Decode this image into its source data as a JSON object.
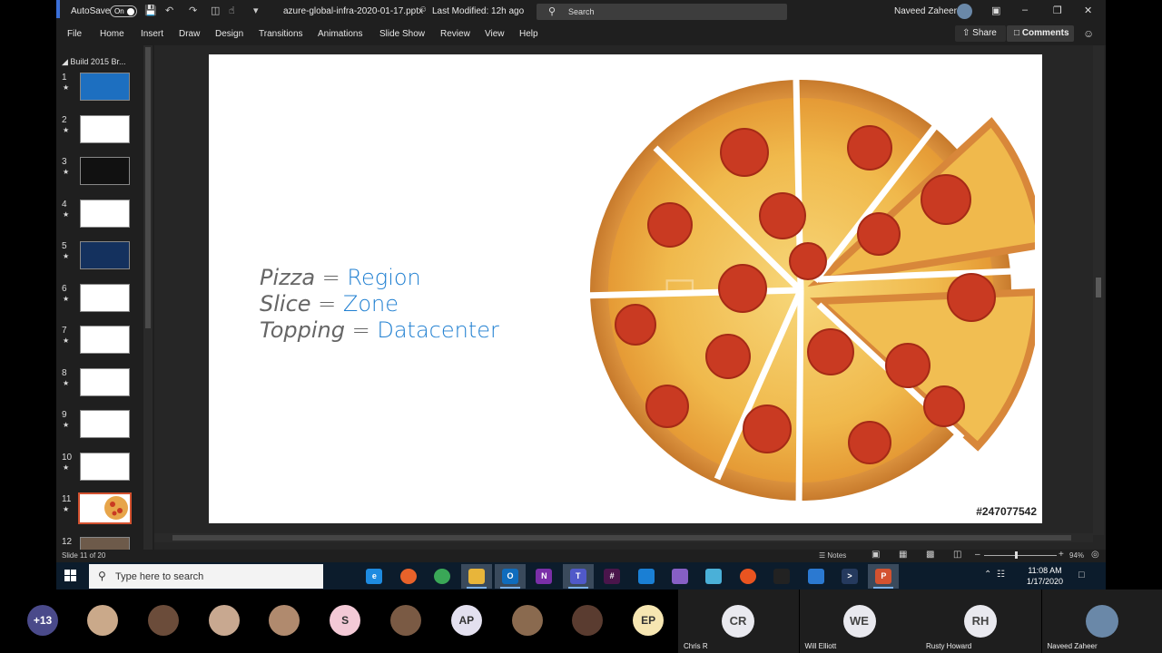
{
  "titlebar": {
    "autosave_label": "AutoSave",
    "autosave_state": "On",
    "filename": "azure-global-infra-2020-01-17.pptx",
    "last_modified": "Last Modified: 12h ago",
    "search_placeholder": "Search",
    "user_name": "Naveed Zaheer"
  },
  "menu": {
    "items": [
      "File",
      "Home",
      "Insert",
      "Draw",
      "Design",
      "Transitions",
      "Animations",
      "Slide Show",
      "Review",
      "View",
      "Help"
    ],
    "share": "Share",
    "comments": "Comments"
  },
  "slides_panel": {
    "section": "Build 2015 Br...",
    "thumbs": [
      {
        "num": "1",
        "bg": "#1d6fc0"
      },
      {
        "num": "2",
        "bg": "#ffffff"
      },
      {
        "num": "3",
        "bg": "#111111"
      },
      {
        "num": "4",
        "bg": "#ffffff"
      },
      {
        "num": "5",
        "bg": "#14315e"
      },
      {
        "num": "6",
        "bg": "#ffffff"
      },
      {
        "num": "7",
        "bg": "#ffffff"
      },
      {
        "num": "8",
        "bg": "#ffffff"
      },
      {
        "num": "9",
        "bg": "#ffffff"
      },
      {
        "num": "10",
        "bg": "#ffffff"
      },
      {
        "num": "11",
        "bg": "#ffffff"
      },
      {
        "num": "12",
        "bg": "#6d5a4a"
      }
    ],
    "active": "11"
  },
  "slide": {
    "lines": [
      {
        "key": "Pizza",
        "op": " = ",
        "value": "Region"
      },
      {
        "key": "Slice",
        "op": " = ",
        "value": "Zone"
      },
      {
        "key": "Topping",
        "op": " = ",
        "value": "Datacenter"
      }
    ],
    "stock_id": "#247077542",
    "value_color": "#1f7fd1"
  },
  "status": {
    "slide_number": "Slide 11 of 20",
    "notes": "Notes",
    "zoom": "94%"
  },
  "taskbar": {
    "search_placeholder": "Type here to search",
    "time": "11:08 AM",
    "date": "1/17/2020",
    "apps": [
      {
        "name": "task-view",
        "label": "",
        "color": "#0c1c2c"
      },
      {
        "name": "edge",
        "label": "e",
        "color": "#1e8be0"
      },
      {
        "name": "firefox",
        "label": "",
        "color": "#e8622a"
      },
      {
        "name": "chrome",
        "label": "",
        "color": "#3aa757"
      },
      {
        "name": "file-explorer",
        "label": "",
        "color": "#e8b53a"
      },
      {
        "name": "outlook",
        "label": "O",
        "color": "#0f6cbd"
      },
      {
        "name": "onenote",
        "label": "N",
        "color": "#7a2fa8"
      },
      {
        "name": "teams",
        "label": "T",
        "color": "#5059c9"
      },
      {
        "name": "slack",
        "label": "#",
        "color": "#4a154b"
      },
      {
        "name": "vscode",
        "label": "",
        "color": "#1a7fd4"
      },
      {
        "name": "visual-studio",
        "label": "",
        "color": "#865fc5"
      },
      {
        "name": "azure-storage",
        "label": "",
        "color": "#4ab0d8"
      },
      {
        "name": "ubuntu",
        "label": "",
        "color": "#e95420"
      },
      {
        "name": "terminal",
        "label": "",
        "color": "#222222"
      },
      {
        "name": "remote-desktop",
        "label": "",
        "color": "#2b79d1"
      },
      {
        "name": "powershell",
        "label": ">",
        "color": "#253a5e"
      },
      {
        "name": "powerpoint",
        "label": "P",
        "color": "#d35230"
      }
    ]
  },
  "meeting": {
    "overflow": "+13",
    "avatars": [
      {
        "initials": "",
        "bg": "#caa98a"
      },
      {
        "initials": "",
        "bg": "#6b4c3a"
      },
      {
        "initials": "",
        "bg": "#c8a890"
      },
      {
        "initials": "",
        "bg": "#b08a6e"
      },
      {
        "initials": "S",
        "bg": "#f3c9d6"
      },
      {
        "initials": "",
        "bg": "#7a5a44"
      },
      {
        "initials": "AP",
        "bg": "#e3e0ef"
      },
      {
        "initials": "",
        "bg": "#8a6a4f"
      },
      {
        "initials": "",
        "bg": "#5a3c30"
      },
      {
        "initials": "EP",
        "bg": "#f6e6b2"
      }
    ],
    "tiles": [
      {
        "initials": "CR",
        "name": "Chris R"
      },
      {
        "initials": "WE",
        "name": "Will Elliott"
      },
      {
        "initials": "RH",
        "name": "Rusty Howard"
      },
      {
        "initials": "",
        "name": "Naveed Zaheer"
      }
    ]
  }
}
